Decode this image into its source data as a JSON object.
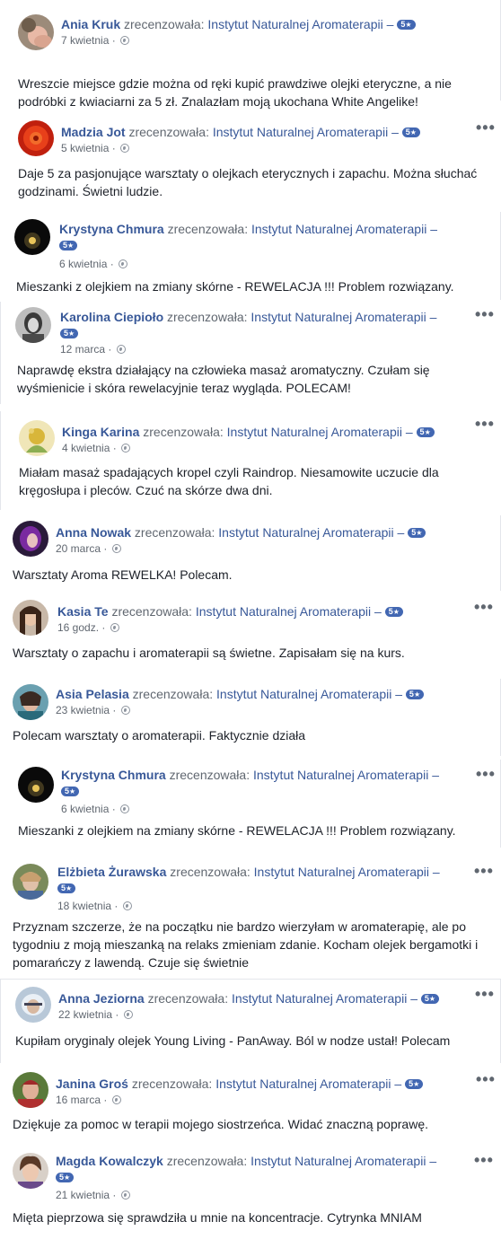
{
  "common": {
    "verb": "zrecenzowała:",
    "page": "Instytut Naturalnej Aromaterapii",
    "dash": "–",
    "rating": "5",
    "star": "★",
    "dot": "·",
    "more": "•••"
  },
  "reviews": [
    {
      "name": "Ania Kruk",
      "date": "7 kwietnia",
      "text": "Wreszcie miejsce gdzie można od ręki kupić prawdziwe olejki eteryczne, a nie podróbki z kwiaciarni za 5 zł. Znalazłam moją ukochana White Angelike!"
    },
    {
      "name": "Madzia Jot",
      "date": "5 kwietnia",
      "text": "Daje 5 za pasjonujące warsztaty o olejkach eterycznych i zapachu. Można słuchać godzinami. Świetni ludzie."
    },
    {
      "name": "Krystyna Chmura",
      "date": "6 kwietnia",
      "text": "Mieszanki z olejkiem na zmiany skórne - REWELACJA !!! Problem rozwiązany."
    },
    {
      "name": "Karolina Ciepioło",
      "date": "12 marca",
      "text": "Naprawdę ekstra działający na człowieka masaż aromatyczny. Czułam się wyśmienicie i skóra rewelacyjnie teraz wygląda. POLECAM!"
    },
    {
      "name": "Kinga Karina",
      "date": "4 kwietnia",
      "text": "Miałam masaż spadających kropel czyli Raindrop. Niesamowite uczucie dla kręgosłupa i pleców. Czuć na skórze dwa dni."
    },
    {
      "name": "Anna Nowak",
      "date": "20 marca",
      "text": "Warsztaty Aroma REWELKA! Polecam."
    },
    {
      "name": "Kasia Te",
      "date": "16 godz.",
      "text": "Warsztaty o zapachu i aromaterapii są świetne. Zapisałam się na kurs."
    },
    {
      "name": "Asia Pelasia",
      "date": "23 kwietnia",
      "text": "Polecam warsztaty o aromaterapii. Faktycznie działa"
    },
    {
      "name": "Krystyna Chmura",
      "date": "6 kwietnia",
      "text": "Mieszanki z olejkiem na zmiany skórne - REWELACJA !!! Problem rozwiązany."
    },
    {
      "name": "Elżbieta Żurawska",
      "date": "18 kwietnia",
      "text": "Przyznam szczerze, że na początku nie bardzo wierzyłam w aromaterapię, ale po tygodniu z moją mieszanką na relaks zmieniam zdanie. Kocham olejek bergamotki i pomarańczy z lawendą. Czuje się świetnie"
    },
    {
      "name": "Anna Jeziorna",
      "date": "22 kwietnia",
      "text": "Kupiłam oryginaly olejek Young Living - PanAway. Ból w nodze ustał! Polecam"
    },
    {
      "name": "Janina Groś",
      "date": "16 marca",
      "text": "Dziękuje za pomoc w terapii mojego siostrzeńca. Widać znaczną poprawę."
    },
    {
      "name": "Magda Kowalczyk",
      "date": "21 kwietnia",
      "text": "Mięta pieprzowa się sprawdziła u mnie na koncentracje. Cytrynka MNIAM"
    }
  ],
  "colors": {
    "link": "#385898",
    "badge": "#4267b2",
    "meta": "#606770",
    "text": "#1d2129"
  }
}
